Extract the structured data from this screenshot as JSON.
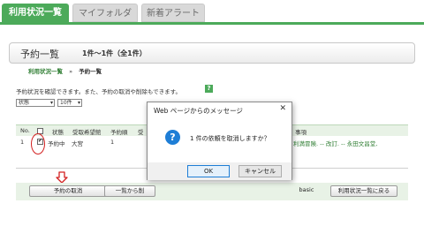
{
  "tabs": [
    {
      "label": "利用状況一覧"
    },
    {
      "label": "マイフォルダ"
    },
    {
      "label": "新着アラート"
    }
  ],
  "heading": {
    "title": "予約一覧",
    "count": "1件～1件（全1件）"
  },
  "breadcrumb": {
    "link": "利用状況一覧",
    "sep": "»",
    "current": "予約一覧"
  },
  "description": "予約状況を確認できます。また、予約の取消や削除もできます。",
  "help_icon": "?",
  "filters": {
    "status": "状態",
    "per_page": "10件"
  },
  "table": {
    "headers": [
      "No.",
      "状態",
      "受取希望館",
      "予約順",
      "受"
    ],
    "right_header": "事項",
    "rows": [
      {
        "no": "1",
        "checked": true,
        "status": "予約中",
        "branch": "大宮",
        "order": "1",
        "detail": "利満冒険. -- 改訂. -- 永田文昌堂,"
      }
    ]
  },
  "arrow_icon": "⇩",
  "buttons": {
    "cancel_reservation": "予約の取消",
    "remove_from_list": "一覧から削",
    "basic": "basic",
    "back_to_status": "利用状況一覧に戻る"
  },
  "dialog": {
    "title": "Web ページからのメッセージ",
    "close": "✕",
    "icon": "?",
    "message": "1 件の依頼を取消しますか？",
    "ok": "OK",
    "cancel": "キャンセル"
  },
  "colors": {
    "accent": "#4caa5a",
    "link": "#2e7d32",
    "highlight": "#d32020",
    "dialog_icon": "#1e7ed6"
  }
}
